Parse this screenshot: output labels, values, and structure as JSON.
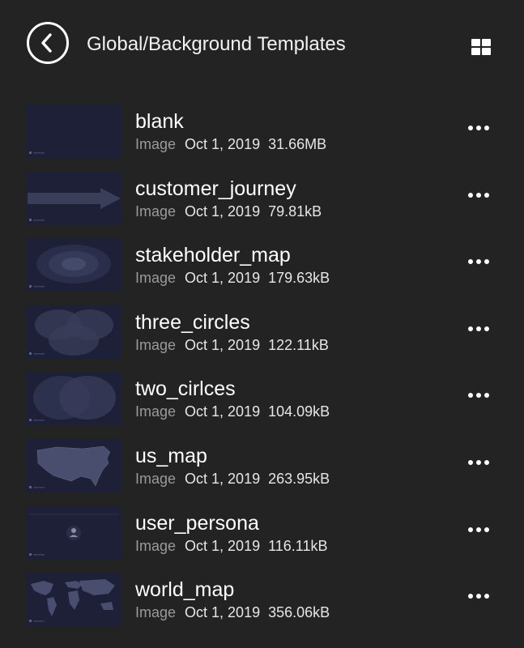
{
  "header": {
    "title": "Global/Background Templates"
  },
  "items": [
    {
      "name": "blank",
      "type": "Image",
      "date": "Oct 1, 2019",
      "size": "31.66MB",
      "thumb_icon": "blank-thumbnail"
    },
    {
      "name": "customer_journey",
      "type": "Image",
      "date": "Oct 1, 2019",
      "size": "79.81kB",
      "thumb_icon": "arrow-thumbnail"
    },
    {
      "name": "stakeholder_map",
      "type": "Image",
      "date": "Oct 1, 2019",
      "size": "179.63kB",
      "thumb_icon": "concentric-ellipses-thumbnail"
    },
    {
      "name": "three_circles",
      "type": "Image",
      "date": "Oct 1, 2019",
      "size": "122.11kB",
      "thumb_icon": "three-circles-thumbnail"
    },
    {
      "name": "two_cirlces",
      "type": "Image",
      "date": "Oct 1, 2019",
      "size": "104.09kB",
      "thumb_icon": "two-circles-thumbnail"
    },
    {
      "name": "us_map",
      "type": "Image",
      "date": "Oct 1, 2019",
      "size": "263.95kB",
      "thumb_icon": "us-map-thumbnail"
    },
    {
      "name": "user_persona",
      "type": "Image",
      "date": "Oct 1, 2019",
      "size": "116.11kB",
      "thumb_icon": "persona-thumbnail"
    },
    {
      "name": "world_map",
      "type": "Image",
      "date": "Oct 1, 2019",
      "size": "356.06kB",
      "thumb_icon": "world-map-thumbnail"
    }
  ],
  "colors": {
    "background": "#232323",
    "thumbnail": "#1d2037",
    "meta_type": "#9a9a9a",
    "text": "#ffffff"
  }
}
